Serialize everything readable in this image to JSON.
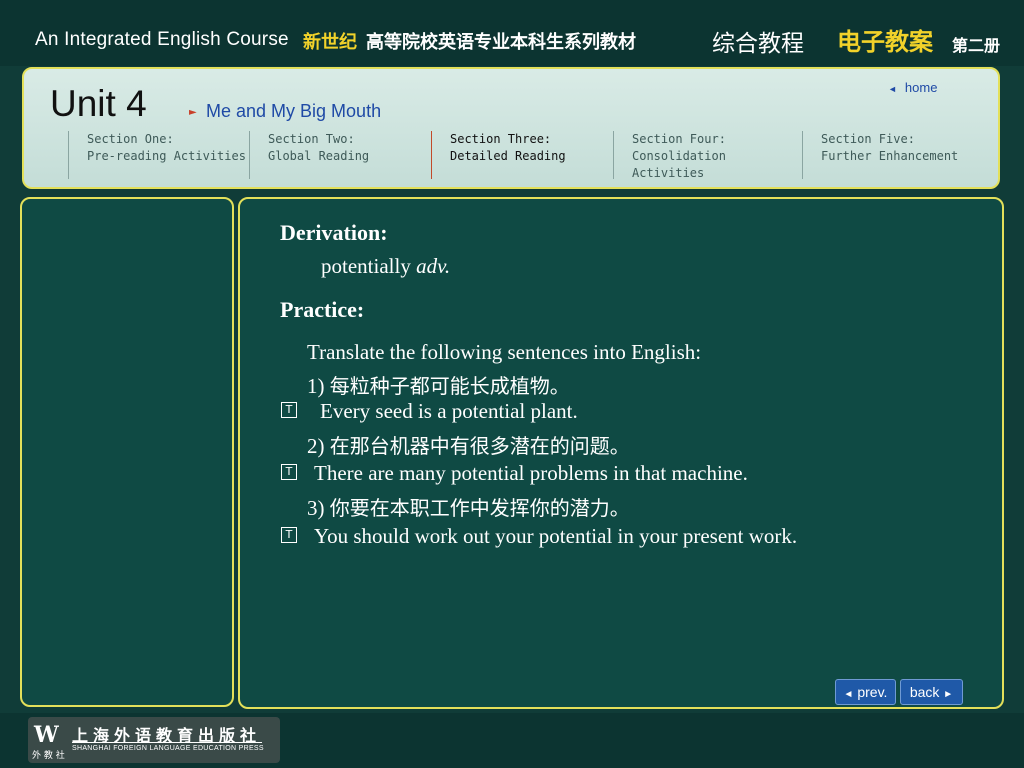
{
  "top_bar": {
    "course_title": "An Integrated English Course",
    "cn_series_highlight": "新世纪",
    "cn_series_rest": "高等院校英语专业本科生系列教材",
    "cn_comprehensive": "综合教程",
    "cn_e_lesson": "电子教案",
    "cn_volume": "第二册"
  },
  "header": {
    "unit_title": "Unit 4",
    "unit_subtitle": "Me and My Big Mouth",
    "home_label": "home",
    "sections": [
      {
        "line1": "Section One:",
        "line2": "Pre-reading Activities",
        "active": false
      },
      {
        "line1": "Section Two:",
        "line2": "Global Reading",
        "active": false
      },
      {
        "line1": "Section Three:",
        "line2": "Detailed Reading",
        "active": true
      },
      {
        "line1": "Section Four:",
        "line2": "Consolidation Activities",
        "active": false
      },
      {
        "line1": "Section Five:",
        "line2": "Further Enhancement",
        "active": false
      }
    ]
  },
  "content": {
    "derivation_heading": "Derivation:",
    "derivation_word": "potentially",
    "derivation_pos": "adv.",
    "practice_heading": "Practice:",
    "instruction": "Translate the following sentences into English:",
    "items": [
      {
        "number": "1)",
        "chinese": "每粒种子都可能长成植物。",
        "answer": "Every seed is a potential plant."
      },
      {
        "number": "2)",
        "chinese": "在那台机器中有很多潜在的问题。",
        "answer": "There are many potential problems in that machine."
      },
      {
        "number": "3)",
        "chinese": "你要在本职工作中发挥你的潜力。",
        "answer": "You should work out your potential in your present work."
      }
    ],
    "answer_marker": "T"
  },
  "nav": {
    "prev_label": "prev.",
    "back_label": "back"
  },
  "footer": {
    "publisher_cn": "上海外语教育出版社",
    "publisher_en": "SHANGHAI FOREIGN LANGUAGE EDUCATION PRESS",
    "logo_mark": "W",
    "logo_small": "外 教 社"
  },
  "colors": {
    "background": "#103c38",
    "panel": "#0f4a44",
    "border_yellow": "#e3e05a",
    "accent_yellow": "#f2d22a",
    "link_blue": "#1f4aa6",
    "button_blue": "#1f59a8"
  }
}
